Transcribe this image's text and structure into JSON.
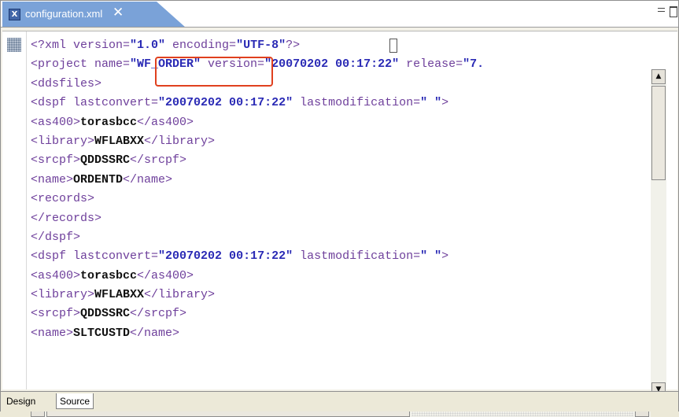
{
  "editor_tab": {
    "title": "configuration.xml",
    "close_glyph": "✕",
    "icon": "xml-file-icon"
  },
  "window_controls": {
    "minimize": "minimize-icon",
    "maximize": "maximize-icon"
  },
  "code_lines": [
    [
      {
        "c": "t-pi",
        "s": "<?xml "
      },
      {
        "c": "t-attr",
        "s": "version="
      },
      {
        "c": "t-val",
        "s": "\"1.0\""
      },
      {
        "c": "t-attr",
        "s": " encoding="
      },
      {
        "c": "t-val",
        "s": "\"UTF-8\""
      },
      {
        "c": "t-pi",
        "s": "?>"
      }
    ],
    [
      {
        "c": "t-tag",
        "s": "<project "
      },
      {
        "c": "t-attr",
        "s": "name="
      },
      {
        "c": "t-val",
        "s": "\"WF_ORDER\""
      },
      {
        "c": "t-attr",
        "s": " version="
      },
      {
        "c": "t-val",
        "s": "\"20070202 00:17:22\""
      },
      {
        "c": "t-attr",
        "s": " release="
      },
      {
        "c": "t-val",
        "s": "\"7."
      }
    ],
    [
      {
        "c": "t-tag",
        "s": "<ddsfiles>"
      }
    ],
    [
      {
        "c": "t-tag",
        "s": "<dspf "
      },
      {
        "c": "t-attr",
        "s": "lastconvert="
      },
      {
        "c": "t-val",
        "s": "\"20070202 00:17:22\""
      },
      {
        "c": "t-attr",
        "s": " lastmodification="
      },
      {
        "c": "t-val",
        "s": "\" \""
      },
      {
        "c": "t-tag",
        "s": ">"
      }
    ],
    [
      {
        "c": "t-tag",
        "s": "<as400>"
      },
      {
        "c": "t-text",
        "s": "torasbcc"
      },
      {
        "c": "t-tag",
        "s": "</as400>"
      }
    ],
    [
      {
        "c": "t-tag",
        "s": "<library>"
      },
      {
        "c": "t-text",
        "s": "WFLABXX"
      },
      {
        "c": "t-tag",
        "s": "</library>"
      }
    ],
    [
      {
        "c": "t-tag",
        "s": "<srcpf>"
      },
      {
        "c": "t-text",
        "s": "QDDSSRC"
      },
      {
        "c": "t-tag",
        "s": "</srcpf>"
      }
    ],
    [
      {
        "c": "t-tag",
        "s": "<name>"
      },
      {
        "c": "t-text",
        "s": "ORDENTD"
      },
      {
        "c": "t-tag",
        "s": "</name>"
      }
    ],
    [
      {
        "c": "t-tag",
        "s": "<records>"
      }
    ],
    [
      {
        "c": "t-tag",
        "s": "</records>"
      }
    ],
    [
      {
        "c": "t-tag",
        "s": "</dspf>"
      }
    ],
    [
      {
        "c": "t-tag",
        "s": "<dspf "
      },
      {
        "c": "t-attr",
        "s": "lastconvert="
      },
      {
        "c": "t-val",
        "s": "\"20070202 00:17:22\""
      },
      {
        "c": "t-attr",
        "s": " lastmodification="
      },
      {
        "c": "t-val",
        "s": "\" \""
      },
      {
        "c": "t-tag",
        "s": ">"
      }
    ],
    [
      {
        "c": "t-tag",
        "s": "<as400>"
      },
      {
        "c": "t-text",
        "s": "torasbcc"
      },
      {
        "c": "t-tag",
        "s": "</as400>"
      }
    ],
    [
      {
        "c": "t-tag",
        "s": "<library>"
      },
      {
        "c": "t-text",
        "s": "WFLABXX"
      },
      {
        "c": "t-tag",
        "s": "</library>"
      }
    ],
    [
      {
        "c": "t-tag",
        "s": "<srcpf>"
      },
      {
        "c": "t-text",
        "s": "QDDSSRC"
      },
      {
        "c": "t-tag",
        "s": "</srcpf>"
      }
    ],
    [
      {
        "c": "t-tag",
        "s": "<name>"
      },
      {
        "c": "t-text",
        "s": "SLTCUSTD"
      },
      {
        "c": "t-tag",
        "s": "</name>"
      }
    ]
  ],
  "scrollbars": {
    "up_arrow": "▲",
    "down_arrow": "▼",
    "left_arrow": "◀",
    "right_arrow": "▶"
  },
  "bottom_tabs": {
    "design": "Design",
    "source": "Source",
    "active": "Source"
  },
  "colors": {
    "tab_active": "#7aa2d8",
    "highlight_box": "#e0401e",
    "tag": "#6e3f9b",
    "value": "#2a2ab5"
  }
}
